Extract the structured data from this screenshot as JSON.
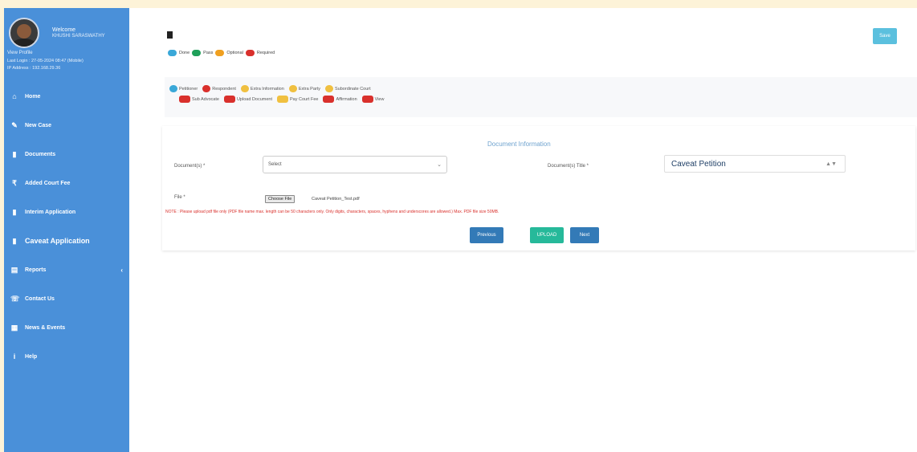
{
  "sidebar": {
    "welcome": "Welcome",
    "username": "KHUSHI SARASWATHY",
    "view_profile": "View Profile",
    "last_login": "Last Login : 27-05-2024 08:47 (Mobile)",
    "ip_address": "IP Address : 192.168.29.36",
    "items": [
      {
        "label": "Home",
        "icon": "home-icon"
      },
      {
        "label": "New Case",
        "icon": "edit-icon"
      },
      {
        "label": "Documents",
        "icon": "file-icon"
      },
      {
        "label": "Added Court Fee",
        "icon": "rupee-icon"
      },
      {
        "label": "Interim Application",
        "icon": "file-icon"
      },
      {
        "label": "Caveat Application",
        "icon": "file-icon"
      },
      {
        "label": "Reports",
        "icon": "report-icon"
      },
      {
        "label": "Contact Us",
        "icon": "contact-icon"
      },
      {
        "label": "News & Events",
        "icon": "news-icon"
      },
      {
        "label": "Help",
        "icon": "info-icon"
      }
    ]
  },
  "header": {
    "save_label": "Save"
  },
  "legend": [
    {
      "label": "Done",
      "color": "#3aa8d8"
    },
    {
      "label": "Pass",
      "color": "#1fa05a"
    },
    {
      "label": "Optional",
      "color": "#f0a020"
    },
    {
      "label": "Required",
      "color": "#d9302c"
    }
  ],
  "tabs_row1": [
    {
      "label": "Petitioner",
      "color": "#3aa8d8"
    },
    {
      "label": "Respondent",
      "color": "#d9302c"
    },
    {
      "label": "Extra Information",
      "color": "#f0c040"
    },
    {
      "label": "Extra Party",
      "color": "#f0c040"
    },
    {
      "label": "Subordinate Court",
      "color": "#f0c040"
    }
  ],
  "tabs_row2": [
    {
      "label": "Sub Advocate",
      "color": "#d9302c"
    },
    {
      "label": "Upload Document",
      "color": "#d9302c"
    },
    {
      "label": "Pay Court Fee",
      "color": "#f0c040"
    },
    {
      "label": "Affirmation",
      "color": "#d9302c"
    },
    {
      "label": "View",
      "color": "#d9302c"
    }
  ],
  "form": {
    "title": "Document Information",
    "document_label": "Document(s) *",
    "document_value": "Select",
    "document_title_label": "Document(s) Title *",
    "document_title_value": "Caveat Petition",
    "file_label": "File *",
    "choose_file_label": "Choose File",
    "file_name": "Caveat Petition_Test.pdf",
    "note": "NOTE : Please upload pdf file only (PDF file name max. length can be 50 characters only. Only digits, characters, spaces, hyphens and underscores are allowed.) Max. PDF file size 50MB.",
    "previous_label": "Previous",
    "upload_label": "UPLOAD",
    "next_label": "Next"
  }
}
